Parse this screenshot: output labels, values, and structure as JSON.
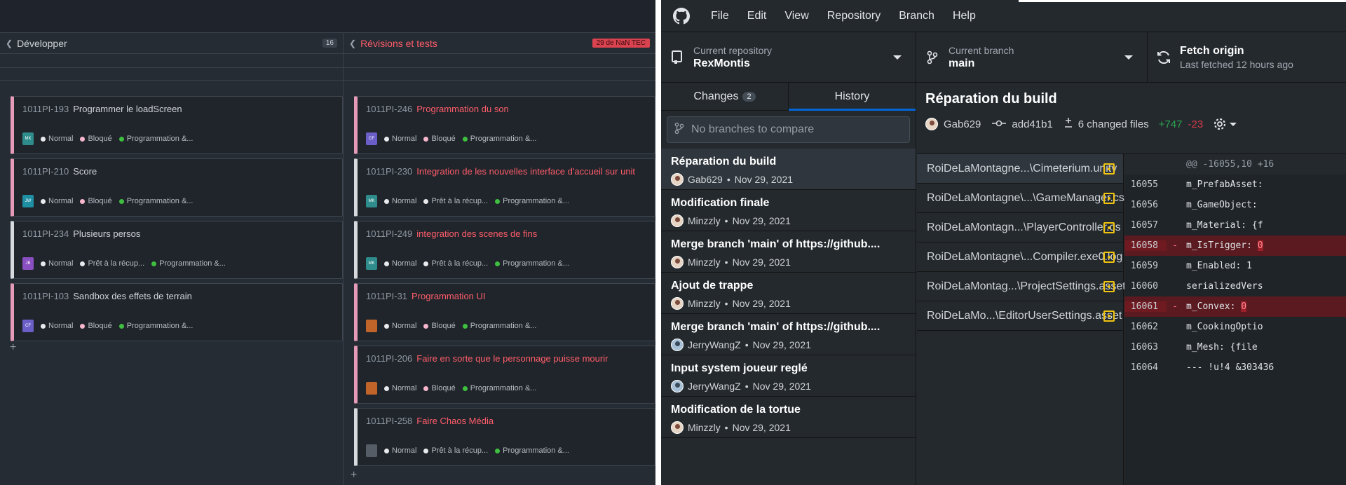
{
  "kanban": {
    "columns": [
      {
        "title": "Développer",
        "count": "16",
        "cards": [
          {
            "id": "1011PI-193",
            "title": "Programmer le loadScreen",
            "avatar": "MK",
            "avatar_color": "#2f8c8c",
            "priority": "Normal",
            "status": "Bloqué",
            "status_color": "#f7b6cc",
            "category": "Programmation &...",
            "accent": "#e59bb8",
            "title_color": "#d1d5da"
          },
          {
            "id": "1011PI-210",
            "title": "Score",
            "avatar": "JW",
            "avatar_color": "#1f8fa3",
            "priority": "Normal",
            "status": "Bloqué",
            "status_color": "#f7b6cc",
            "category": "Programmation &...",
            "accent": "#e59bb8",
            "title_color": "#d1d5da"
          },
          {
            "id": "1011PI-234",
            "title": "Plusieurs persos",
            "avatar": "JB",
            "avatar_color": "#8a4fc0",
            "priority": "Normal",
            "status": "Prêt à la récup...",
            "status_color": "#e8eaed",
            "category": "Programmation &...",
            "accent": "#d6dade",
            "title_color": "#d1d5da"
          },
          {
            "id": "1011PI-103",
            "title": "Sandbox des effets de terrain",
            "avatar": "CF",
            "avatar_color": "#6b5fc7",
            "priority": "Normal",
            "status": "Bloqué",
            "status_color": "#f7b6cc",
            "category": "Programmation &...",
            "accent": "#e59bb8",
            "title_color": "#d1d5da"
          }
        ]
      },
      {
        "title": "Révisions et tests",
        "badge": "29 de NaN TEC",
        "cards": [
          {
            "id": "1011PI-246",
            "title": "Programmation du son",
            "avatar": "CF",
            "avatar_color": "#6b5fc7",
            "priority": "Normal",
            "status": "Bloqué",
            "status_color": "#f7b6cc",
            "category": "Programmation &...",
            "accent": "#e59bb8",
            "title_color": "#ff5d6a"
          },
          {
            "id": "1011PI-230",
            "title": "Integration de les nouvelles interface d'accueil sur unit",
            "avatar": "MK",
            "avatar_color": "#2f8c8c",
            "priority": "Normal",
            "status": "Prêt à la récup...",
            "status_color": "#e8eaed",
            "category": "Programmation &...",
            "accent": "#d6dade",
            "title_color": "#ff5d6a"
          },
          {
            "id": "1011PI-249",
            "title": "integration des scenes de fins",
            "avatar": "MK",
            "avatar_color": "#2f8c8c",
            "priority": "Normal",
            "status": "Prêt à la récup...",
            "status_color": "#e8eaed",
            "category": "Programmation &...",
            "accent": "#d6dade",
            "title_color": "#ff5d6a"
          },
          {
            "id": "1011PI-31",
            "title": "Programmation UI",
            "avatar": "",
            "avatar_color": "#c0642a",
            "priority": "Normal",
            "status": "Bloqué",
            "status_color": "#f7b6cc",
            "category": "Programmation &...",
            "accent": "#e59bb8",
            "title_color": "#ff5d6a"
          },
          {
            "id": "1011PI-206",
            "title": "Faire en sorte que le personnage puisse mourir",
            "avatar": "",
            "avatar_color": "#c0642a",
            "priority": "Normal",
            "status": "Bloqué",
            "status_color": "#f7b6cc",
            "category": "Programmation &...",
            "accent": "#e59bb8",
            "title_color": "#ff5d6a"
          },
          {
            "id": "1011PI-258",
            "title": "Faire Chaos Média",
            "avatar": "",
            "avatar_color": "#555c66",
            "priority": "Normal",
            "status": "Prêt à la récup...",
            "status_color": "#e8eaed",
            "category": "Programmation &...",
            "accent": "#d6dade",
            "title_color": "#ff5d6a"
          }
        ]
      }
    ],
    "add_symbol": "+"
  },
  "github": {
    "menu": [
      "File",
      "Edit",
      "View",
      "Repository",
      "Branch",
      "Help"
    ],
    "toolbar": {
      "repo_label": "Current repository",
      "repo_value": "RexMontis",
      "branch_label": "Current branch",
      "branch_value": "main",
      "fetch_label": "Fetch origin",
      "fetch_sub": "Last fetched 12 hours ago"
    },
    "tabs": {
      "changes": "Changes",
      "changes_count": "2",
      "history": "History"
    },
    "branch_compare_placeholder": "No branches to compare",
    "commits": [
      {
        "summary": "Réparation du build",
        "author": "Gab629",
        "date": "Nov 29, 2021",
        "avatar": "a"
      },
      {
        "summary": "Modification finale",
        "author": "Minzzly",
        "date": "Nov 29, 2021",
        "avatar": "a"
      },
      {
        "summary": "Merge branch 'main' of https://github....",
        "author": "Minzzly",
        "date": "Nov 29, 2021",
        "avatar": "a"
      },
      {
        "summary": "Ajout de trappe",
        "author": "Minzzly",
        "date": "Nov 29, 2021",
        "avatar": "a"
      },
      {
        "summary": "Merge branch 'main' of https://github....",
        "author": "JerryWangZ",
        "date": "Nov 29, 2021",
        "avatar": "b"
      },
      {
        "summary": "Input system joueur reglé",
        "author": "JerryWangZ",
        "date": "Nov 29, 2021",
        "avatar": "b"
      },
      {
        "summary": "Modification de la tortue",
        "author": "Minzzly",
        "date": "Nov 29, 2021",
        "avatar": "a"
      }
    ],
    "selected_commit": {
      "summary": "Réparation du build",
      "author": "Gab629",
      "sha": "add41b1",
      "changed_files": "6 changed files",
      "additions": "+747",
      "deletions": "-23"
    },
    "files": [
      "RoiDeLaMontagne...\\Cimeterium.unity",
      "RoiDeLaMontagne\\...\\GameManager.cs",
      "RoiDeLaMontagn...\\PlayerController.cs",
      "RoiDeLaMontagne\\...Compiler.exe0.log",
      "RoiDeLaMontag...\\ProjectSettings.asset",
      "RoiDeLaMo...\\EditorUserSettings.asset"
    ],
    "diff": {
      "hunk": "@@ -16055,10 +16",
      "lines": [
        {
          "ln": "16055",
          "mark": "",
          "code": "  m_PrefabAsset:",
          "type": "ctx",
          "hl": ""
        },
        {
          "ln": "16056",
          "mark": "",
          "code": "  m_GameObject: ",
          "type": "ctx",
          "hl": ""
        },
        {
          "ln": "16057",
          "mark": "",
          "code": "  m_Material: {f",
          "type": "ctx",
          "hl": ""
        },
        {
          "ln": "16058",
          "mark": "-",
          "code": "  m_IsTrigger: ",
          "type": "del",
          "hl": "0"
        },
        {
          "ln": "16059",
          "mark": "",
          "code": "  m_Enabled: 1",
          "type": "ctx",
          "hl": ""
        },
        {
          "ln": "16060",
          "mark": "",
          "code": "  serializedVers",
          "type": "ctx",
          "hl": ""
        },
        {
          "ln": "16061",
          "mark": "-",
          "code": "  m_Convex: ",
          "type": "del",
          "hl": "0"
        },
        {
          "ln": "16062",
          "mark": "",
          "code": "  m_CookingOptio",
          "type": "ctx",
          "hl": ""
        },
        {
          "ln": "16063",
          "mark": "",
          "code": "  m_Mesh: {file",
          "type": "ctx",
          "hl": ""
        },
        {
          "ln": "16064",
          "mark": "",
          "code": "--- !u!4 &303436",
          "type": "ctx",
          "hl": ""
        }
      ]
    }
  }
}
